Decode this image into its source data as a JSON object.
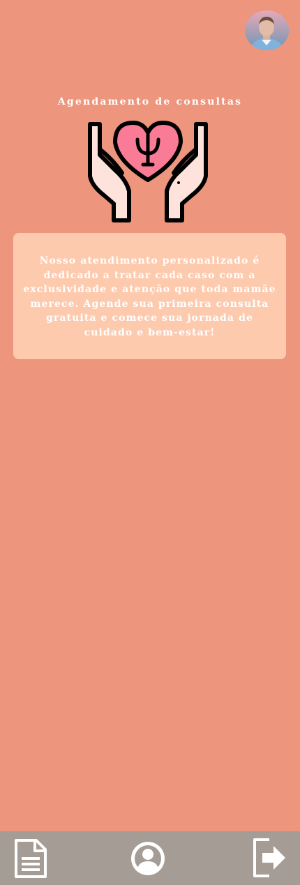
{
  "header": {
    "avatar_icon": "user-avatar-photo"
  },
  "main": {
    "title": "Agendamento de consultas",
    "hero_icon": "psychology-hands-heart-icon",
    "card_text": "Nosso atendimento personalizado é dedicado a tratar cada caso com a exclusividade e atenção que toda mamãe merece. Agende sua primeira consulta gratuita e comece sua jornada de cuidado e bem-estar!"
  },
  "bottom_nav": {
    "items": [
      {
        "icon": "document-icon"
      },
      {
        "icon": "user-circle-icon"
      },
      {
        "icon": "logout-icon"
      }
    ]
  },
  "colors": {
    "background": "#ED967D",
    "card": "#FECAAE",
    "nav_bar": "#A49C95",
    "heart": "#FA7B96",
    "hands": "#FDE3DC"
  }
}
